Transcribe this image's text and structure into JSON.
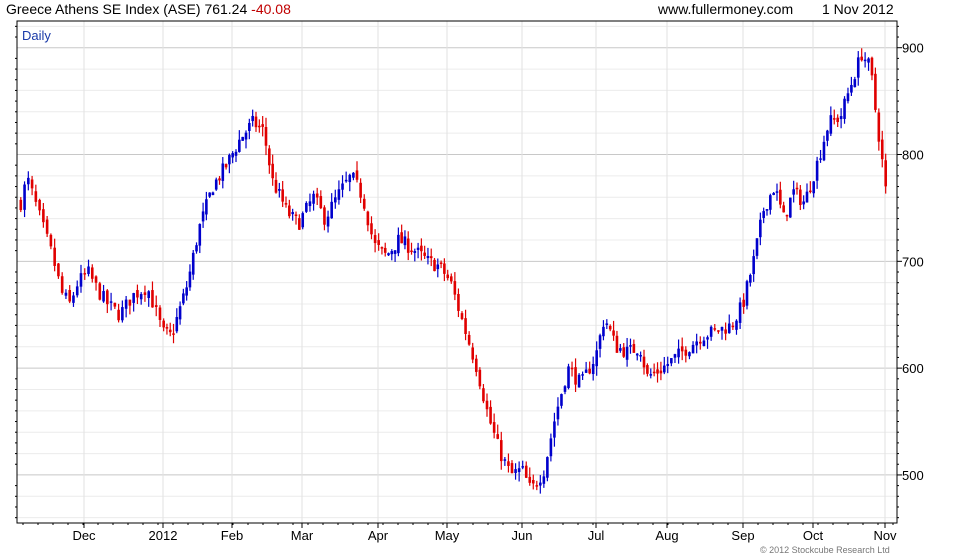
{
  "header": {
    "title": "Greece Athens SE Index (ASE)",
    "last": "761.24",
    "change": "-40.08",
    "site": "www.fullermoney.com",
    "date": "1 Nov 2012"
  },
  "chart_label": "Daily",
  "copyright": "© 2012 Stockcube Research Ltd",
  "colors": {
    "up": "#0000cc",
    "down": "#e00000",
    "grid": "#d4d4d4",
    "frame": "#000000"
  },
  "chart_data": {
    "type": "ohlc",
    "frequency": "daily",
    "ylim": [
      455,
      925
    ],
    "yticks": [
      500,
      600,
      700,
      800,
      900
    ],
    "xticks": [
      {
        "label": "Dec",
        "t": 0.0
      },
      {
        "label": "2012",
        "t": 1.0
      },
      {
        "label": "Feb",
        "t": 2.0
      },
      {
        "label": "Mar",
        "t": 3.0
      },
      {
        "label": "Apr",
        "t": 4.0
      },
      {
        "label": "May",
        "t": 5.0
      },
      {
        "label": "Jun",
        "t": 6.0
      },
      {
        "label": "Jul",
        "t": 7.0
      },
      {
        "label": "Aug",
        "t": 8.0
      },
      {
        "label": "Sep",
        "t": 9.0
      },
      {
        "label": "Oct",
        "t": 10.0
      },
      {
        "label": "Nov",
        "t": 11.0
      }
    ],
    "grid": true,
    "anchors": [
      {
        "t": -0.8,
        "v": 755
      },
      {
        "t": -0.72,
        "v": 778
      },
      {
        "t": -0.64,
        "v": 760
      },
      {
        "t": -0.52,
        "v": 732
      },
      {
        "t": -0.4,
        "v": 705
      },
      {
        "t": -0.28,
        "v": 670
      },
      {
        "t": -0.18,
        "v": 660
      },
      {
        "t": -0.08,
        "v": 680
      },
      {
        "t": 0.05,
        "v": 690
      },
      {
        "t": 0.18,
        "v": 672
      },
      {
        "t": 0.3,
        "v": 660
      },
      {
        "t": 0.45,
        "v": 650
      },
      {
        "t": 0.62,
        "v": 668
      },
      {
        "t": 0.8,
        "v": 676
      },
      {
        "t": 0.9,
        "v": 655
      },
      {
        "t": 1.0,
        "v": 633
      },
      {
        "t": 1.12,
        "v": 630
      },
      {
        "t": 1.22,
        "v": 650
      },
      {
        "t": 1.36,
        "v": 680
      },
      {
        "t": 1.52,
        "v": 730
      },
      {
        "t": 1.72,
        "v": 770
      },
      {
        "t": 1.92,
        "v": 790
      },
      {
        "t": 2.12,
        "v": 815
      },
      {
        "t": 2.3,
        "v": 830
      },
      {
        "t": 2.45,
        "v": 822
      },
      {
        "t": 2.58,
        "v": 775
      },
      {
        "t": 2.8,
        "v": 745
      },
      {
        "t": 2.95,
        "v": 735
      },
      {
        "t": 3.15,
        "v": 760
      },
      {
        "t": 3.3,
        "v": 740
      },
      {
        "t": 3.5,
        "v": 765
      },
      {
        "t": 3.65,
        "v": 780
      },
      {
        "t": 3.8,
        "v": 760
      },
      {
        "t": 3.95,
        "v": 715
      },
      {
        "t": 4.12,
        "v": 705
      },
      {
        "t": 4.3,
        "v": 720
      },
      {
        "t": 4.5,
        "v": 712
      },
      {
        "t": 4.72,
        "v": 700
      },
      {
        "t": 4.9,
        "v": 695
      },
      {
        "t": 5.05,
        "v": 680
      },
      {
        "t": 5.2,
        "v": 645
      },
      {
        "t": 5.4,
        "v": 600
      },
      {
        "t": 5.55,
        "v": 555
      },
      {
        "t": 5.7,
        "v": 522
      },
      {
        "t": 5.85,
        "v": 500
      },
      {
        "t": 6.0,
        "v": 505
      },
      {
        "t": 6.12,
        "v": 485
      },
      {
        "t": 6.3,
        "v": 505
      },
      {
        "t": 6.45,
        "v": 555
      },
      {
        "t": 6.62,
        "v": 600
      },
      {
        "t": 6.8,
        "v": 585
      },
      {
        "t": 7.0,
        "v": 612
      },
      {
        "t": 7.12,
        "v": 648
      },
      {
        "t": 7.28,
        "v": 620
      },
      {
        "t": 7.45,
        "v": 615
      },
      {
        "t": 7.62,
        "v": 620
      },
      {
        "t": 7.72,
        "v": 592
      },
      {
        "t": 7.9,
        "v": 598
      },
      {
        "t": 8.08,
        "v": 608
      },
      {
        "t": 8.25,
        "v": 618
      },
      {
        "t": 8.45,
        "v": 630
      },
      {
        "t": 8.65,
        "v": 635
      },
      {
        "t": 8.85,
        "v": 640
      },
      {
        "t": 9.0,
        "v": 660
      },
      {
        "t": 9.15,
        "v": 700
      },
      {
        "t": 9.3,
        "v": 750
      },
      {
        "t": 9.45,
        "v": 770
      },
      {
        "t": 9.58,
        "v": 740
      },
      {
        "t": 9.72,
        "v": 765
      },
      {
        "t": 9.88,
        "v": 755
      },
      {
        "t": 10.05,
        "v": 790
      },
      {
        "t": 10.22,
        "v": 830
      },
      {
        "t": 10.38,
        "v": 835
      },
      {
        "t": 10.55,
        "v": 870
      },
      {
        "t": 10.68,
        "v": 895
      },
      {
        "t": 10.8,
        "v": 880
      },
      {
        "t": 10.88,
        "v": 835
      },
      {
        "t": 10.95,
        "v": 800
      },
      {
        "t": 11.02,
        "v": 761
      }
    ]
  }
}
